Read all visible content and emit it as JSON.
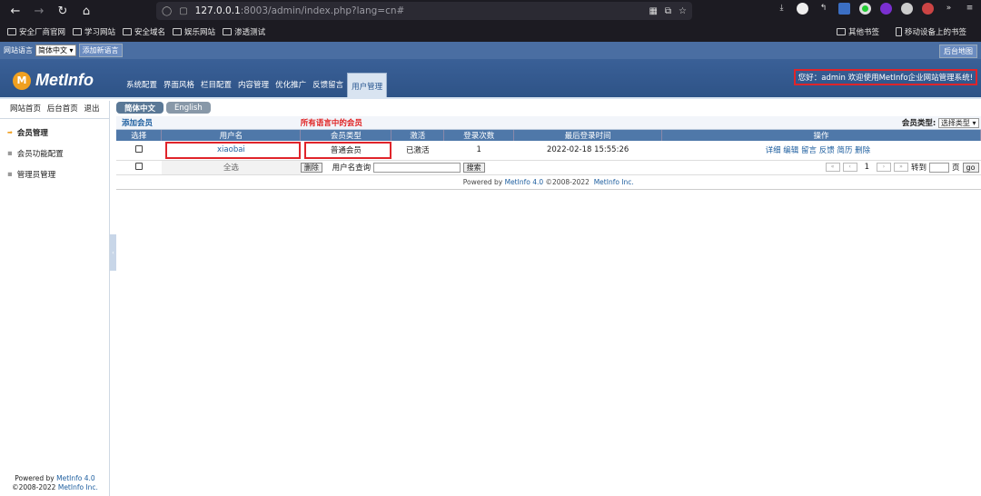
{
  "browser": {
    "url_host": "127.0.0.1",
    "url_path": ":8003/admin/index.php?lang=cn#"
  },
  "bookmarks": {
    "items": [
      "安全厂商官网",
      "学习网站",
      "安全域名",
      "娱乐网站",
      "渗透测试"
    ],
    "other": "其他书签",
    "mobile": "移动设备上的书签"
  },
  "langbar": {
    "label": "网站语言",
    "selected": "简体中文",
    "add_button": "添加新语言",
    "sitemap_button": "后台地图"
  },
  "header": {
    "logo": "MetInfo",
    "logo_mark": "M",
    "menu": [
      "系统配置",
      "界面风格",
      "栏目配置",
      "内容管理",
      "优化推广",
      "反馈留言",
      "用户管理"
    ],
    "welcome": "您好：admin   欢迎使用MetInfo企业网站管理系统!"
  },
  "sidebar": {
    "toplinks": [
      "网站首页",
      "后台首页",
      "退出"
    ],
    "items": [
      "会员管理",
      "会员功能配置",
      "管理员管理"
    ],
    "footer_line1": "Powered by",
    "footer_link1": "MetInfo 4.0",
    "footer_line2": "©2008-2022",
    "footer_link2": "MetInfo Inc."
  },
  "main": {
    "tabs": [
      "简体中文",
      "English"
    ],
    "add_member": "添加会员",
    "all_members": "所有语言中的会员",
    "member_type_label": "会员类型:",
    "member_type_selected": "选择类型",
    "columns": [
      "选择",
      "用户名",
      "会员类型",
      "激活",
      "登录次数",
      "最后登录时间",
      "操作"
    ],
    "rows": [
      {
        "username": "xiaobai",
        "type": "普通会员",
        "activated": "已激活",
        "logins": "1",
        "last_login": "2022-02-18 15:55:26",
        "ops": [
          "详细",
          "编辑",
          "留言",
          "反馈",
          "简历",
          "删除"
        ]
      }
    ],
    "select_all": "全选",
    "delete_button": "删除",
    "search_label": "用户名查询",
    "search_button": "搜索",
    "pager": {
      "first": "«",
      "prev": "‹",
      "page": "1",
      "next": "›",
      "last": "»",
      "goto": "转到",
      "page_unit": "页",
      "go": "go"
    },
    "powered": "Powered by",
    "powered_link": "MetInfo 4.0",
    "copyright": "©2008-2022",
    "copyright_link": "MetInfo Inc."
  }
}
